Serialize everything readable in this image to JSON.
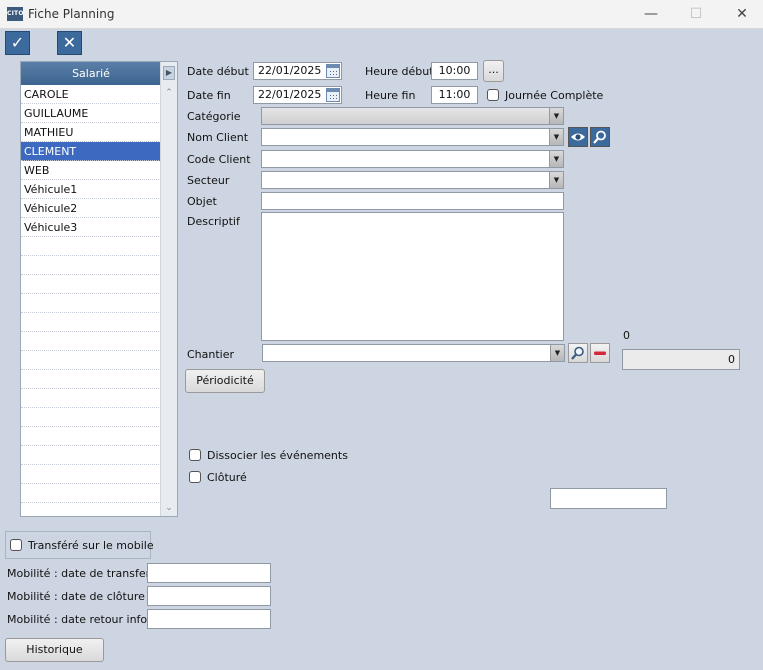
{
  "window": {
    "title": "Fiche Planning",
    "icon_text": "CITO"
  },
  "toolbar": {
    "validate_icon": "check-icon",
    "cancel_icon": "close-icon"
  },
  "employees": {
    "header": "Salarié",
    "items": [
      "CAROLE",
      "GUILLAUME",
      "MATHIEU",
      "CLEMENT",
      "WEB",
      "Véhicule1",
      "Véhicule2",
      "Véhicule3"
    ],
    "selected_index": 3
  },
  "form": {
    "date_debut_label": "Date début",
    "date_debut_value": "22/01/2025",
    "heure_debut_label": "Heure début",
    "heure_debut_value": "10:00",
    "more_label": "...",
    "date_fin_label": "Date fin",
    "date_fin_value": "22/01/2025",
    "heure_fin_label": "Heure fin",
    "heure_fin_value": "11:00",
    "journee_label": "Journée Complète",
    "categorie_label": "Catégorie",
    "nom_client_label": "Nom Client",
    "code_client_label": "Code Client",
    "secteur_label": "Secteur",
    "objet_label": "Objet",
    "descriptif_label": "Descriptif",
    "chantier_label": "Chantier",
    "periodicite_label": "Périodicité",
    "dissocier_label": "Dissocier les événements",
    "cloture_label": "Clôturé"
  },
  "counter": {
    "top_value": "0",
    "field_value": "0"
  },
  "mobile": {
    "transfere_label": "Transféré sur le mobile",
    "date_transfert_label": "Mobilité : date de transfert",
    "date_cloture_label": "Mobilité : date de clôture",
    "date_retour_label": "Mobilité : date retour info"
  },
  "historique_label": "Historique"
}
